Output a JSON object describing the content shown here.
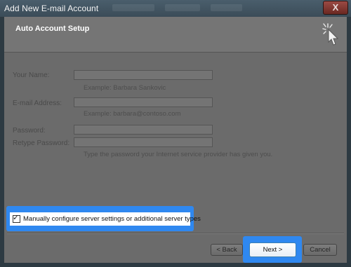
{
  "window": {
    "title": "Add New E-mail Account",
    "close_label": "X"
  },
  "header": {
    "title": "Auto Account Setup"
  },
  "form": {
    "your_name_label": "Your Name:",
    "your_name_value": "",
    "your_name_hint": "Example: Barbara Sankovic",
    "email_label": "E-mail Address:",
    "email_value": "",
    "email_hint": "Example: barbara@contoso.com",
    "password_label": "Password:",
    "password_value": "",
    "retype_label": "Retype Password:",
    "retype_value": "",
    "password_hint": "Type the password your Internet service provider has given you."
  },
  "manual_config": {
    "label": "Manually configure server settings or additional server types",
    "checked": true
  },
  "buttons": {
    "back": "< Back",
    "next": "Next >",
    "cancel": "Cancel"
  },
  "colors": {
    "highlight": "#2f88f0"
  }
}
